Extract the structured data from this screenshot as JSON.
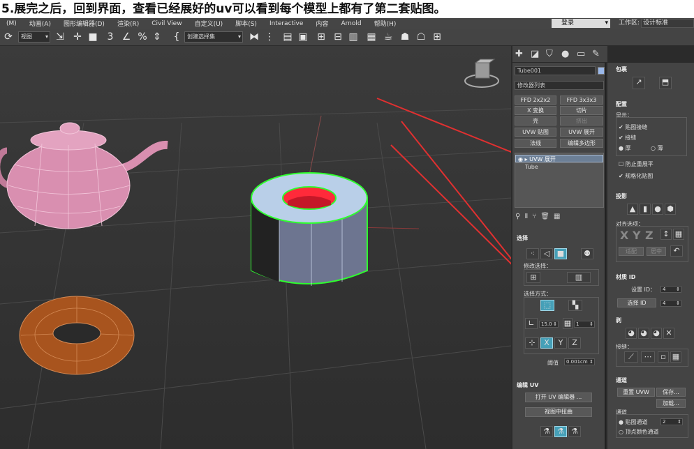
{
  "caption": "5.展完之后，回到界面，查看已经展好的uv可以看到每个模型上都有了第二套贴图。",
  "menu": {
    "items": [
      "(M)",
      "动画(A)",
      "图形编辑器(D)",
      "渲染(R)",
      "Civil View",
      "自定义(U)",
      "脚本(S)",
      "Interactive",
      "内容",
      "Arnold",
      "帮助(H)"
    ],
    "sign_in": "登录",
    "workspace_label": "工作区:",
    "workspace_value": "设计标准"
  },
  "toolbar": {
    "view_dropdown": "视图",
    "selection_set_dropdown": "创建选择集"
  },
  "command_panel": {
    "object_name": "Tube001",
    "modifier_list": "修改器列表",
    "modifier_buttons": [
      {
        "label": "FFD 2x2x2",
        "enabled": true
      },
      {
        "label": "FFD 3x3x3",
        "enabled": true
      },
      {
        "label": "X 变换",
        "enabled": true
      },
      {
        "label": "切片",
        "enabled": true
      },
      {
        "label": "壳",
        "enabled": true
      },
      {
        "label": "挤出",
        "enabled": false
      },
      {
        "label": "UVW 贴图",
        "enabled": true
      },
      {
        "label": "UVW 展开",
        "enabled": true
      },
      {
        "label": "法线",
        "enabled": true
      },
      {
        "label": "编辑多边形",
        "enabled": true
      }
    ],
    "stack": [
      "UVW 展开",
      "Tube"
    ],
    "selection": {
      "title": "选择",
      "modify_selection": "修改选择：",
      "method": "选择方式：",
      "angle_value": "15.0",
      "spin_value": "1",
      "threshold_label": "阈值",
      "threshold_value": "0.001cm"
    },
    "edit_uv": {
      "title": "编辑 UV",
      "open_editor": "打开 UV 编辑器 ...",
      "center_view": "视图中扭曲"
    }
  },
  "right_panel": {
    "wrap_title": "包裹",
    "config_title": "配置",
    "display_label": "显示：",
    "checkboxes": [
      "贴图接缝",
      "接缝"
    ],
    "radio_thick": "厚",
    "radio_thin": "薄",
    "prevent_reflatten": "防止重展平",
    "normalize_map": "规格化贴图",
    "projection_title": "投影",
    "align_options": "对齐选项：",
    "align_axes": [
      "X",
      "Y",
      "Z"
    ],
    "fit_btn": "适配",
    "center_btn": "居中",
    "material_id_title": "材质 ID",
    "set_id_label": "设置 ID：",
    "set_id_value": "4",
    "select_id_label": "选择 ID",
    "select_id_value": "4",
    "peel_title": "剥",
    "seams_label": "接缝：",
    "channel_title": "通道",
    "reset_uvw": "重置 UVW",
    "save": "保存...",
    "load": "加载...",
    "channel_label": "通道",
    "map_channel": "贴图通道",
    "map_channel_value": "2",
    "vertex_color_channel": "顶点颜色通道"
  },
  "colors": {
    "teapot": "#d98fb0",
    "torus": "#a8541e",
    "tube_side": "#6d7590",
    "tube_top": "#b9cfe8",
    "selection_wire": "#2eff2e",
    "inner_face": "#ff2a3a",
    "arrow": "#e03030"
  }
}
